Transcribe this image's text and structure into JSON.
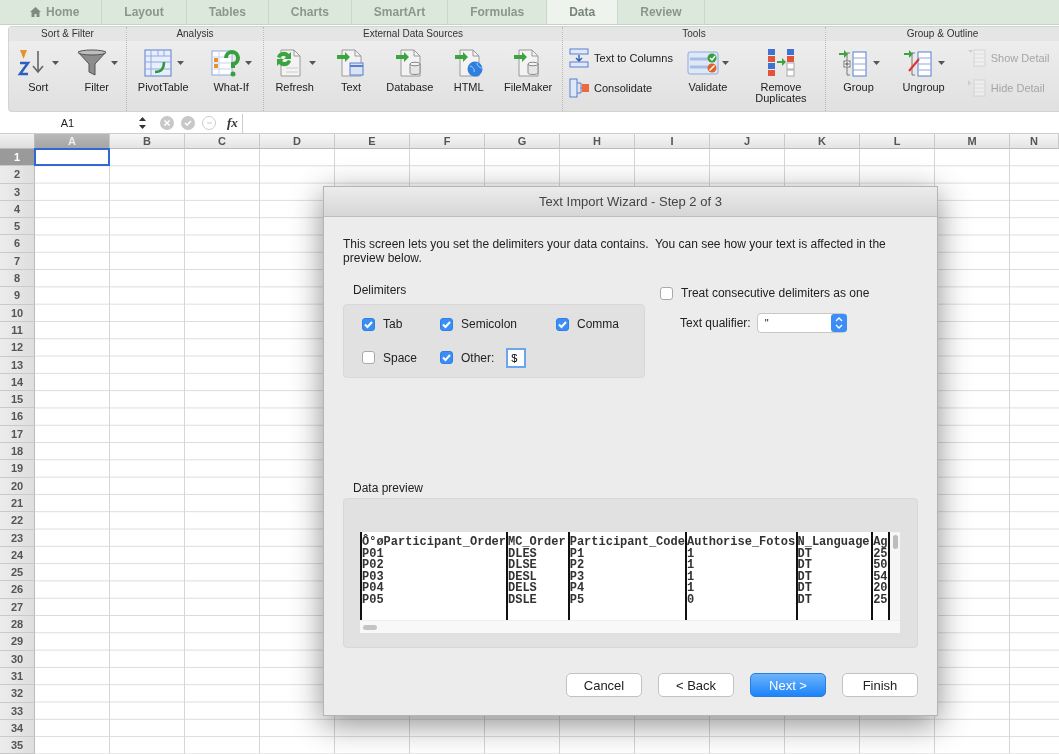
{
  "tabs": [
    {
      "label": "Home",
      "kind": "home",
      "selected": false
    },
    {
      "label": "Layout",
      "kind": "plain",
      "selected": false
    },
    {
      "label": "Tables",
      "kind": "plain",
      "selected": false
    },
    {
      "label": "Charts",
      "kind": "plain",
      "selected": false
    },
    {
      "label": "SmartArt",
      "kind": "plain",
      "selected": false
    },
    {
      "label": "Formulas",
      "kind": "plain",
      "selected": false
    },
    {
      "label": "Data",
      "kind": "plain",
      "selected": true
    },
    {
      "label": "Review",
      "kind": "plain",
      "selected": false
    }
  ],
  "ribbon": {
    "groups": [
      {
        "title": "Sort & Filter",
        "items": [
          {
            "kind": "large",
            "label": "Sort",
            "dropdown": true
          },
          {
            "kind": "large",
            "label": "Filter",
            "dropdown": true
          }
        ]
      },
      {
        "title": "Analysis",
        "items": [
          {
            "kind": "large",
            "label": "PivotTable",
            "dropdown": true
          },
          {
            "kind": "large",
            "label": "What-If",
            "dropdown": true
          }
        ]
      },
      {
        "title": "External Data Sources",
        "items": [
          {
            "kind": "large",
            "label": "Refresh",
            "dropdown": true
          },
          {
            "kind": "large",
            "label": "Text",
            "dropdown": false
          },
          {
            "kind": "large",
            "label": "Database",
            "dropdown": false
          },
          {
            "kind": "large",
            "label": "HTML",
            "dropdown": false
          },
          {
            "kind": "large",
            "label": "FileMaker",
            "dropdown": false
          }
        ]
      },
      {
        "title": "Tools",
        "items": [
          {
            "kind": "stack",
            "items": [
              {
                "label": "Text to Columns",
                "disabled": false
              },
              {
                "label": "Consolidate",
                "disabled": false
              }
            ]
          },
          {
            "kind": "large",
            "label": "Validate",
            "dropdown": true
          },
          {
            "kind": "large",
            "label": "Remove Duplicates",
            "dropdown": false
          }
        ]
      },
      {
        "title": "Group & Outline",
        "items": [
          {
            "kind": "large",
            "label": "Group",
            "dropdown": true
          },
          {
            "kind": "large",
            "label": "Ungroup",
            "dropdown": true
          },
          {
            "kind": "stack",
            "items": [
              {
                "label": "Show Detail",
                "disabled": true
              },
              {
                "label": "Hide Detail",
                "disabled": true
              }
            ]
          }
        ]
      }
    ]
  },
  "formula_bar": {
    "name_box": "A1",
    "function_label": "fx"
  },
  "sheet": {
    "columns": [
      {
        "label": "A",
        "selected": true
      },
      {
        "label": "B",
        "selected": false
      },
      {
        "label": "C",
        "selected": false
      },
      {
        "label": "D",
        "selected": false
      },
      {
        "label": "E",
        "selected": false
      },
      {
        "label": "F",
        "selected": false
      },
      {
        "label": "G",
        "selected": false
      },
      {
        "label": "H",
        "selected": false
      },
      {
        "label": "I",
        "selected": false
      },
      {
        "label": "J",
        "selected": false
      },
      {
        "label": "K",
        "selected": false
      },
      {
        "label": "L",
        "selected": false
      },
      {
        "label": "M",
        "selected": false
      },
      {
        "label": "N",
        "selected": false
      }
    ],
    "rows": [
      {
        "label": "1",
        "selected": true
      },
      {
        "label": "2",
        "selected": false
      },
      {
        "label": "3",
        "selected": false
      },
      {
        "label": "4",
        "selected": false
      },
      {
        "label": "5",
        "selected": false
      },
      {
        "label": "6",
        "selected": false
      },
      {
        "label": "7",
        "selected": false
      },
      {
        "label": "8",
        "selected": false
      },
      {
        "label": "9",
        "selected": false
      },
      {
        "label": "10",
        "selected": false
      },
      {
        "label": "11",
        "selected": false
      },
      {
        "label": "12",
        "selected": false
      },
      {
        "label": "13",
        "selected": false
      },
      {
        "label": "14",
        "selected": false
      },
      {
        "label": "15",
        "selected": false
      },
      {
        "label": "16",
        "selected": false
      },
      {
        "label": "17",
        "selected": false
      },
      {
        "label": "18",
        "selected": false
      },
      {
        "label": "19",
        "selected": false
      },
      {
        "label": "20",
        "selected": false
      },
      {
        "label": "21",
        "selected": false
      },
      {
        "label": "22",
        "selected": false
      },
      {
        "label": "23",
        "selected": false
      },
      {
        "label": "24",
        "selected": false
      },
      {
        "label": "25",
        "selected": false
      },
      {
        "label": "26",
        "selected": false
      },
      {
        "label": "27",
        "selected": false
      },
      {
        "label": "28",
        "selected": false
      },
      {
        "label": "29",
        "selected": false
      },
      {
        "label": "30",
        "selected": false
      },
      {
        "label": "31",
        "selected": false
      },
      {
        "label": "32",
        "selected": false
      },
      {
        "label": "33",
        "selected": false
      },
      {
        "label": "34",
        "selected": false
      },
      {
        "label": "35",
        "selected": false
      }
    ]
  },
  "dialog": {
    "title": "Text Import Wizard - Step 2 of 3",
    "description": "This screen lets you set the delimiters your data contains.  You can see how your text is affected in the preview below.",
    "delimiters_label": "Delimiters",
    "delimiters": [
      {
        "label": "Tab",
        "checked": true
      },
      {
        "label": "Semicolon",
        "checked": true
      },
      {
        "label": "Comma",
        "checked": true
      },
      {
        "label": "Space",
        "checked": false
      },
      {
        "label": "Other:",
        "checked": true
      }
    ],
    "other_value": "$",
    "consecutive": {
      "label": "Treat consecutive delimiters as one",
      "checked": false
    },
    "text_qualifier": {
      "label": "Text qualifier:",
      "value": "\""
    },
    "preview_label": "Data preview",
    "preview": {
      "columns": [
        {
          "header": "Ô°øParticipant_Order",
          "values": [
            "P01",
            "P02",
            "P03",
            "P04",
            "P05"
          ]
        },
        {
          "header": "MC_Order",
          "values": [
            "DLES",
            "DLSE",
            "DESL",
            "DELS",
            "DSLE"
          ]
        },
        {
          "header": "Participant_Code",
          "values": [
            "P1",
            "P2",
            "P3",
            "P4",
            "P5"
          ]
        },
        {
          "header": "Authorise_Fotos",
          "values": [
            "1",
            "1",
            "1",
            "1",
            "0"
          ]
        },
        {
          "header": "N_Language",
          "values": [
            "DT",
            "DT",
            "DT",
            "DT",
            "DT"
          ]
        },
        {
          "header": "Ag",
          "values": [
            "25",
            "50",
            "54",
            "20",
            "25"
          ]
        }
      ]
    },
    "buttons": [
      {
        "label": "Cancel",
        "default": false
      },
      {
        "label": "< Back",
        "default": false
      },
      {
        "label": "Next >",
        "default": true
      },
      {
        "label": "Finish",
        "default": false
      }
    ]
  }
}
